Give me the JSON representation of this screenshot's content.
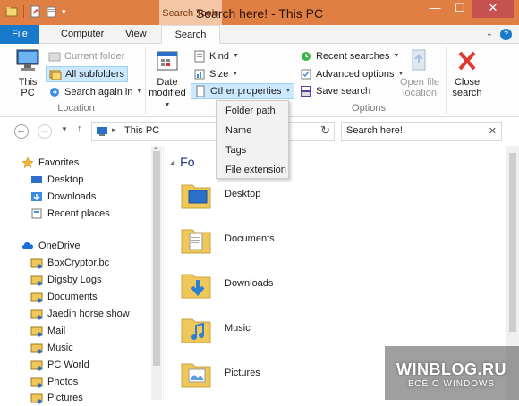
{
  "window": {
    "title": "Search here! - This PC",
    "context_tab_label": "Search Tools",
    "minimize": "—",
    "maximize": "☐",
    "close": "✕"
  },
  "tabs": {
    "file": "File",
    "computer": "Computer",
    "view": "View",
    "search": "Search"
  },
  "ribbon": {
    "location": {
      "label": "Location",
      "this_pc": "This PC",
      "current_folder": "Current folder",
      "all_subfolders": "All subfolders",
      "search_again_in": "Search again in"
    },
    "refine": {
      "date_modified_l1": "Date",
      "date_modified_l2": "modified",
      "kind": "Kind",
      "size": "Size",
      "other_properties": "Other properties"
    },
    "options": {
      "label": "Options",
      "recent_searches": "Recent searches",
      "advanced_options": "Advanced options",
      "save_search": "Save search",
      "open_file_location_l1": "Open file",
      "open_file_location_l2": "location",
      "close_search_l1": "Close",
      "close_search_l2": "search"
    }
  },
  "dropdown": {
    "items": [
      "Folder path",
      "Name",
      "Tags",
      "File extension"
    ]
  },
  "address": {
    "crumb": "This PC",
    "search_value": "Search here!"
  },
  "nav": {
    "favorites": "Favorites",
    "desktop": "Desktop",
    "downloads": "Downloads",
    "recent_places": "Recent places",
    "onedrive": "OneDrive",
    "items": [
      "BoxCryptor.bc",
      "Digsby Logs",
      "Documents",
      "Jaedin horse show",
      "Mail",
      "Music",
      "PC World",
      "Photos",
      "Pictures"
    ]
  },
  "content": {
    "section": "Folders",
    "section_visible": "Fo",
    "folders": [
      "Desktop",
      "Documents",
      "Downloads",
      "Music",
      "Pictures"
    ]
  },
  "watermark": {
    "line1": "WINBLOG.RU",
    "line2": "ВСЁ О WINDOWS"
  },
  "colors": {
    "titlebar": "#e07f43",
    "file_tab": "#1979ca",
    "selection": "#cce8ff",
    "folder": "#f0c85a"
  }
}
